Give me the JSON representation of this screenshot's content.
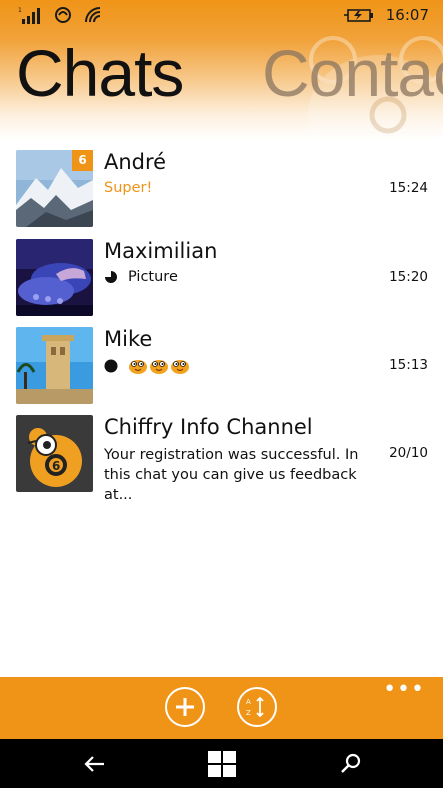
{
  "status_bar": {
    "time": "16:07",
    "signal_icon": "signal-bars-icon",
    "data_icon": "data-connection-icon",
    "wifi_icon": "wifi-icon",
    "battery_icon": "battery-charging-icon"
  },
  "pivot": {
    "active": "Chats",
    "inactive": "Contac"
  },
  "chats": [
    {
      "name": "André",
      "preview": "Super!",
      "time": "15:24",
      "unread": "6",
      "avatar": "mountain-photo"
    },
    {
      "name": "Maximilian",
      "preview": "Picture",
      "time": "15:20",
      "avatar": "dj-mixer-photo",
      "preview_icon": "picture-timer-icon"
    },
    {
      "name": "Mike",
      "preview": "",
      "time": "15:13",
      "avatar": "tower-photo",
      "preview_icon": "dot-icon",
      "emoji": [
        "chick-emoji",
        "chick-emoji",
        "chick-emoji"
      ]
    },
    {
      "name": "Chiffry Info Channel",
      "preview": "Your registration was successful. In this chat you can give us feedback at...",
      "time": "20/10",
      "avatar": "chiffry-logo"
    }
  ],
  "app_bar": {
    "add_icon": "add-icon",
    "sort_icon": "sort-az-icon",
    "more": "•••"
  },
  "nav_bar": {
    "back_icon": "back-arrow-icon",
    "windows_icon": "windows-logo-icon",
    "search_icon": "search-icon"
  },
  "colors": {
    "accent": "#ef9417",
    "navbar": "#000000"
  }
}
